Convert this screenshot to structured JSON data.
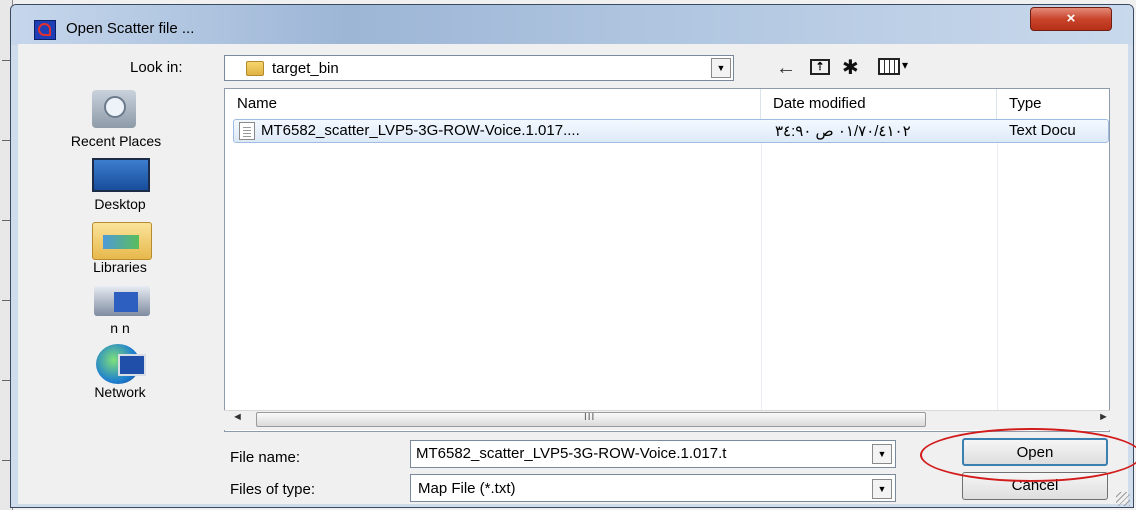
{
  "window": {
    "title": "Open Scatter file ...",
    "close_glyph": "×"
  },
  "toolbar": {
    "look_in_label": "Look in:",
    "look_in_value": "target_bin",
    "dropdown_glyph": "▼",
    "back_glyph": "←",
    "up_glyph": "⇡",
    "new_folder_glyph": "✱",
    "views_dd_glyph": "▾"
  },
  "places": [
    {
      "label": "Recent Places",
      "icon": "recent-places-icon"
    },
    {
      "label": "Desktop",
      "icon": "desktop-icon"
    },
    {
      "label": "Libraries",
      "icon": "libraries-icon"
    },
    {
      "label": "n n",
      "icon": "user-folder-icon"
    },
    {
      "label": "Network",
      "icon": "network-icon"
    }
  ],
  "file_list": {
    "columns": [
      "Name",
      "Date modified",
      "Type"
    ],
    "sort_glyph": "▲",
    "rows": [
      {
        "name": "MT6582_scatter_LVP5-3G-ROW-Voice.1.017....",
        "date": "٢٠١٤/٠٧/١٠ ص ٠٩:٤٣",
        "type": "Text Docu"
      }
    ]
  },
  "scrollbar": {
    "left_glyph": "◄",
    "right_glyph": "►",
    "grip": "III"
  },
  "fields": {
    "file_name_label": "File name:",
    "file_name_value": "MT6582_scatter_LVP5-3G-ROW-Voice.1.017.t",
    "files_of_type_label": "Files of type:",
    "files_of_type_value": "Map File (*.txt)"
  },
  "buttons": {
    "open": "Open",
    "cancel": "Cancel"
  },
  "colors": {
    "highlight_ellipse": "#d21c1c",
    "close_button": "#c8442b",
    "selection": "#dde9f7"
  }
}
